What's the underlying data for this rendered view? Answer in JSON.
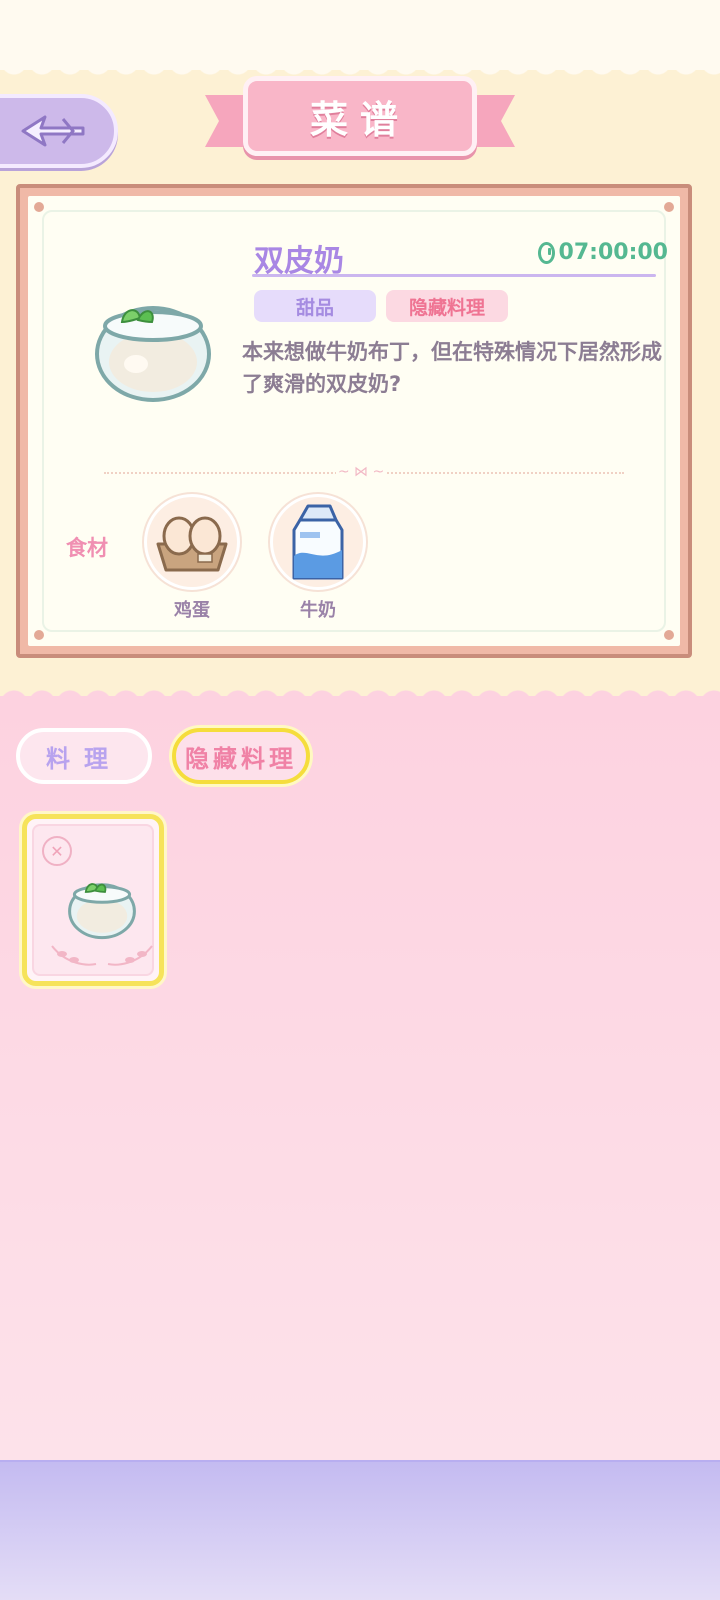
{
  "header": {
    "title": "菜谱",
    "back_icon": "back-arrow-icon"
  },
  "recipe": {
    "name": "双皮奶",
    "timer": "07:00:00",
    "tags": {
      "category": "甜品",
      "hidden": "隐藏料理"
    },
    "description": "本来想做牛奶布丁，但在特殊情况下居然形成了爽滑的双皮奶?",
    "ingredients_label": "食材",
    "ingredients": [
      {
        "name": "鸡蛋",
        "icon": "eggs-icon"
      },
      {
        "name": "牛奶",
        "icon": "milk-carton-icon"
      }
    ]
  },
  "tabs": {
    "dishes": "料理",
    "hidden_dishes": "隐藏料理",
    "active": "hidden_dishes"
  },
  "colors": {
    "accent_purple": "#a987e4",
    "timer_green": "#55b891",
    "hidden_pink": "#ef7493",
    "selected_yellow": "#f6e35a"
  }
}
